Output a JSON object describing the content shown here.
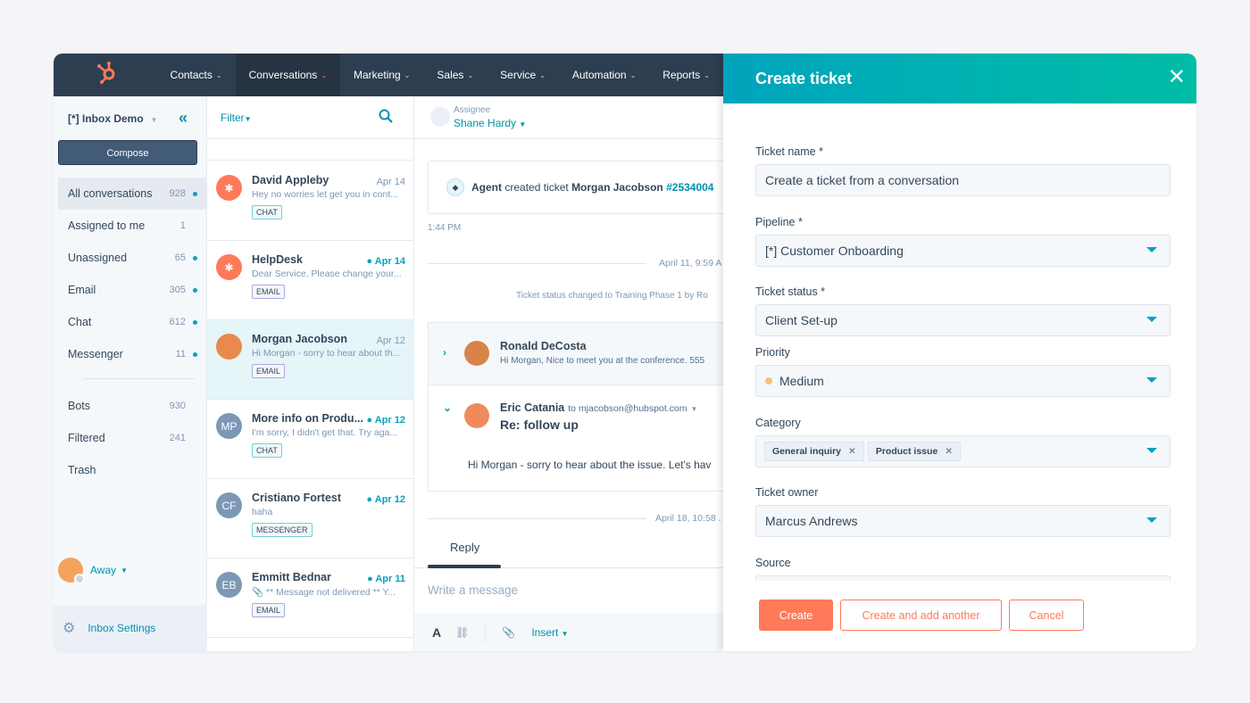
{
  "nav": {
    "items": [
      {
        "label": "Contacts",
        "active": false
      },
      {
        "label": "Conversations",
        "active": true
      },
      {
        "label": "Marketing",
        "active": false
      },
      {
        "label": "Sales",
        "active": false
      },
      {
        "label": "Service",
        "active": false
      },
      {
        "label": "Automation",
        "active": false
      },
      {
        "label": "Reports",
        "active": false
      }
    ]
  },
  "sidebar": {
    "inbox_name": "[*] Inbox Demo",
    "compose_label": "Compose",
    "items": [
      {
        "label": "All conversations",
        "count": "928",
        "unread": true
      },
      {
        "label": "Assigned to me",
        "count": "1",
        "unread": false
      },
      {
        "label": "Unassigned",
        "count": "65",
        "unread": true
      },
      {
        "label": "Email",
        "count": "305",
        "unread": true
      },
      {
        "label": "Chat",
        "count": "612",
        "unread": true
      },
      {
        "label": "Messenger",
        "count": "11",
        "unread": true
      },
      {
        "label": "Bots",
        "count": "930",
        "unread": false
      },
      {
        "label": "Filtered",
        "count": "241",
        "unread": false
      },
      {
        "label": "Trash",
        "count": "",
        "unread": false
      }
    ],
    "status": "Away",
    "settings_label": "Inbox Settings"
  },
  "list": {
    "filter_label": "Filter",
    "conversations": [
      {
        "name": "David Appleby",
        "date": "Apr 14",
        "preview": "Hey no worries let get you in cont...",
        "channel": "CHAT",
        "unread": false,
        "initials": "",
        "avatar": "hubspot"
      },
      {
        "name": "HelpDesk",
        "date": "Apr 14",
        "preview": "Dear Service, Please change your...",
        "channel": "EMAIL",
        "unread": true,
        "initials": "",
        "avatar": "hubspot"
      },
      {
        "name": "Morgan Jacobson",
        "date": "Apr 12",
        "preview": "Hi Morgan - sorry to hear about th...",
        "channel": "EMAIL",
        "unread": false,
        "initials": "",
        "avatar": "photo",
        "selected": true
      },
      {
        "name": "More info on Produ...",
        "date": "Apr 12",
        "preview": "I'm sorry, I didn't get that. Try aga...",
        "channel": "CHAT",
        "unread": true,
        "initials": "MP",
        "avatar": "initials"
      },
      {
        "name": "Cristiano Fortest",
        "date": "Apr 12",
        "preview": "haha",
        "channel": "MESSENGER",
        "unread": true,
        "initials": "CF",
        "avatar": "initials"
      },
      {
        "name": "Emmitt Bednar",
        "date": "Apr 11",
        "preview": "** Message not delivered ** Y...",
        "channel": "EMAIL",
        "unread": true,
        "initials": "EB",
        "avatar": "initials",
        "attachment": true
      }
    ]
  },
  "thread": {
    "assignee_label": "Assignee",
    "assignee": "Shane Hardy",
    "ticket_event": {
      "actor": "Agent",
      "action": "created ticket",
      "contact": "Morgan Jacobson",
      "ticket_id": "#2534004"
    },
    "event_time": "1:44 PM",
    "date_sep_1": "April 11, 9:59 A",
    "status_change": "Ticket status changed to Training Phase 1 by Ro",
    "msg1": {
      "sender": "Ronald DeCosta",
      "preview": "Hi Morgan, Nice to meet you at the conference. 555"
    },
    "msg2": {
      "sender": "Eric Catania",
      "to": "to mjacobson@hubspot.com",
      "subject": "Re: follow up",
      "body": "Hi Morgan - sorry to hear about the issue. Let's hav"
    },
    "date_sep_2": "April 18, 10:58 .",
    "reply_tab": "Reply",
    "composer_placeholder": "Write a message",
    "toolbar": {
      "format": "A",
      "insert": "Insert"
    }
  },
  "panel": {
    "title": "Create ticket",
    "fields": {
      "ticket_name": {
        "label": "Ticket name *",
        "value": "Create a ticket from a conversation"
      },
      "pipeline": {
        "label": "Pipeline *",
        "value": "[*] Customer Onboarding"
      },
      "ticket_status": {
        "label": "Ticket status *",
        "value": "Client Set-up"
      },
      "priority": {
        "label": "Priority",
        "value": "Medium",
        "color": "#f5c26b"
      },
      "category": {
        "label": "Category",
        "values": [
          "General inquiry",
          "Product issue"
        ]
      },
      "ticket_owner": {
        "label": "Ticket owner",
        "value": "Marcus Andrews"
      },
      "source": {
        "label": "Source",
        "value": ""
      }
    },
    "buttons": {
      "create": "Create",
      "create_another": "Create and add another",
      "cancel": "Cancel"
    }
  },
  "colors": {
    "nav": "#2d3e50",
    "accent": "#00a4bd",
    "primary": "#ff7a59",
    "header_gradient_end": "#00bda5"
  }
}
